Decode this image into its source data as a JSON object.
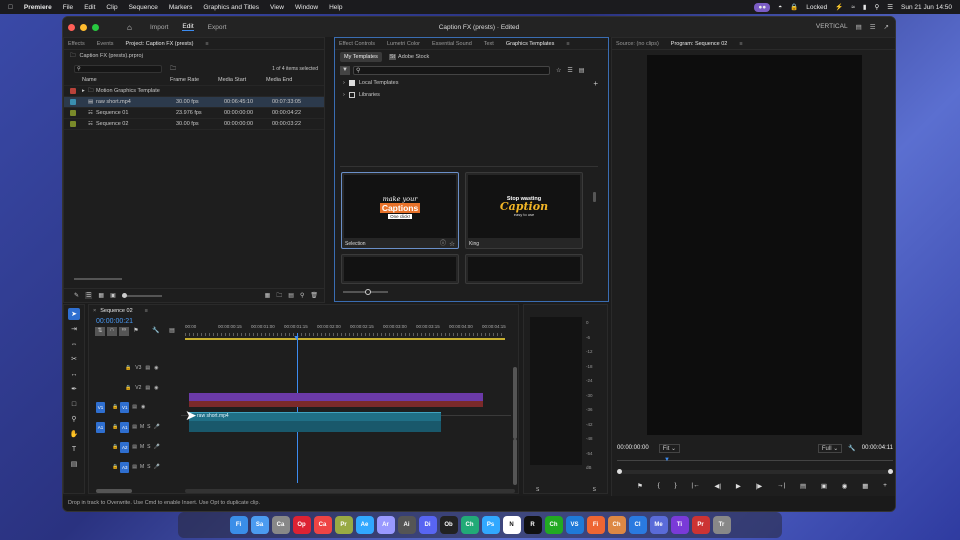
{
  "menubar": {
    "app": "Premiere",
    "items": [
      "File",
      "Edit",
      "Clip",
      "Sequence",
      "Markers",
      "Graphics and Titles",
      "View",
      "Window",
      "Help"
    ],
    "locked": "Locked",
    "datetime": "Sun 21 Jun  14:50"
  },
  "titlebar": {
    "workspaces": [
      "Import",
      "Edit",
      "Export"
    ],
    "active_workspace": "Edit",
    "title": "Caption FX (prests) · Edited",
    "vertical": "VERTICAL"
  },
  "project": {
    "tabs": [
      "Effects",
      "Events",
      "Project: Caption FX (prests)"
    ],
    "file": "Caption FX (prests).prproj",
    "count": "1 of 4 items selected",
    "headers": {
      "name": "Name",
      "frame_rate": "Frame Rate",
      "media_start": "Media Start",
      "media_end": "Media End"
    },
    "rows": [
      {
        "name": "Motion Graphics Template",
        "fr": "",
        "ms": "",
        "me": "",
        "color": "#b8423a"
      },
      {
        "name": "raw short.mp4",
        "fr": "30.00 fps",
        "ms": "00:06:45:10",
        "me": "00:07:33:05",
        "color": "#3a8fb0"
      },
      {
        "name": "Sequence 01",
        "fr": "23.976 fps",
        "ms": "00:00:00:00",
        "me": "00:00:04:22",
        "color": "#7a8a2a"
      },
      {
        "name": "Sequence 02",
        "fr": "30.00 fps",
        "ms": "00:00:00:00",
        "me": "00:00:03:22",
        "color": "#7a8a2a"
      }
    ]
  },
  "eg": {
    "tabs": [
      "Effect Controls",
      "Lumetri Color",
      "Essential Sound",
      "Text",
      "Graphics Templates"
    ],
    "subtabs": [
      "My Templates",
      "Adobe Stock"
    ],
    "local": "Local Templates",
    "libraries": "Libraries",
    "cards": [
      {
        "label": "Selection",
        "l1": "make your",
        "l2": "Captions",
        "l3": "One click!"
      },
      {
        "label": "King",
        "l1": "Stop wasting",
        "l2": "Caption",
        "l3": "easy to use"
      }
    ]
  },
  "program": {
    "tabs": [
      "Source: (no clips)",
      "Program: Sequence 02"
    ],
    "timecode": "00:00:00:00",
    "fit": "Fit",
    "quality": "Full",
    "duration": "00:00:04:11"
  },
  "timeline": {
    "tab": "Sequence 02",
    "timecode": "00:00:00:21",
    "ruler": [
      "00:00",
      "00:00:00:15",
      "00:00:01:00",
      "00:00:01:15",
      "00:00:02:00",
      "00:00:02:15",
      "00:00:03:00",
      "00:00:03:15",
      "00:00:04:00",
      "00:00:04:15"
    ],
    "tracks": [
      "V3",
      "V2",
      "V1",
      "A1",
      "A2",
      "A3"
    ],
    "clip": "raw short.mp4"
  },
  "meter": {
    "ticks": [
      "0",
      "-6",
      "-12",
      "-18",
      "-24",
      "-30",
      "-36",
      "-42",
      "-48",
      "-54"
    ],
    "db": "dB",
    "s1": "S",
    "s2": "S"
  },
  "status": "Drop in track to Overwrite. Use Cmd to enable Insert. Use Opt to duplicate clip.",
  "dock": [
    "Fi",
    "Sa",
    "Ca",
    "Op",
    "Ca",
    "Pr",
    "Ae",
    "Ar",
    "Ai",
    "Di",
    "Ob",
    "Ch",
    "Ps",
    "N",
    "R",
    "Ch",
    "VS",
    "Fi",
    "Ch",
    "Cl",
    "Me",
    "Ti",
    "Pr",
    "Tr"
  ]
}
